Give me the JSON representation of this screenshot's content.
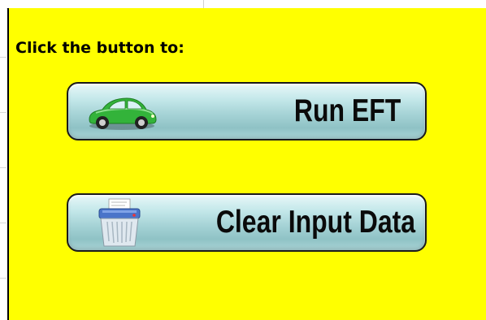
{
  "instruction": "Click the button to:",
  "buttons": {
    "run": {
      "label": "Run EFT",
      "icon": "car-icon"
    },
    "clear": {
      "label": "Clear Input Data",
      "icon": "shredder-icon"
    }
  },
  "colors": {
    "panel": "#ffff00",
    "button_top": "#e8f7f8",
    "button_bottom": "#8fc2c5",
    "car": "#33b33a"
  }
}
